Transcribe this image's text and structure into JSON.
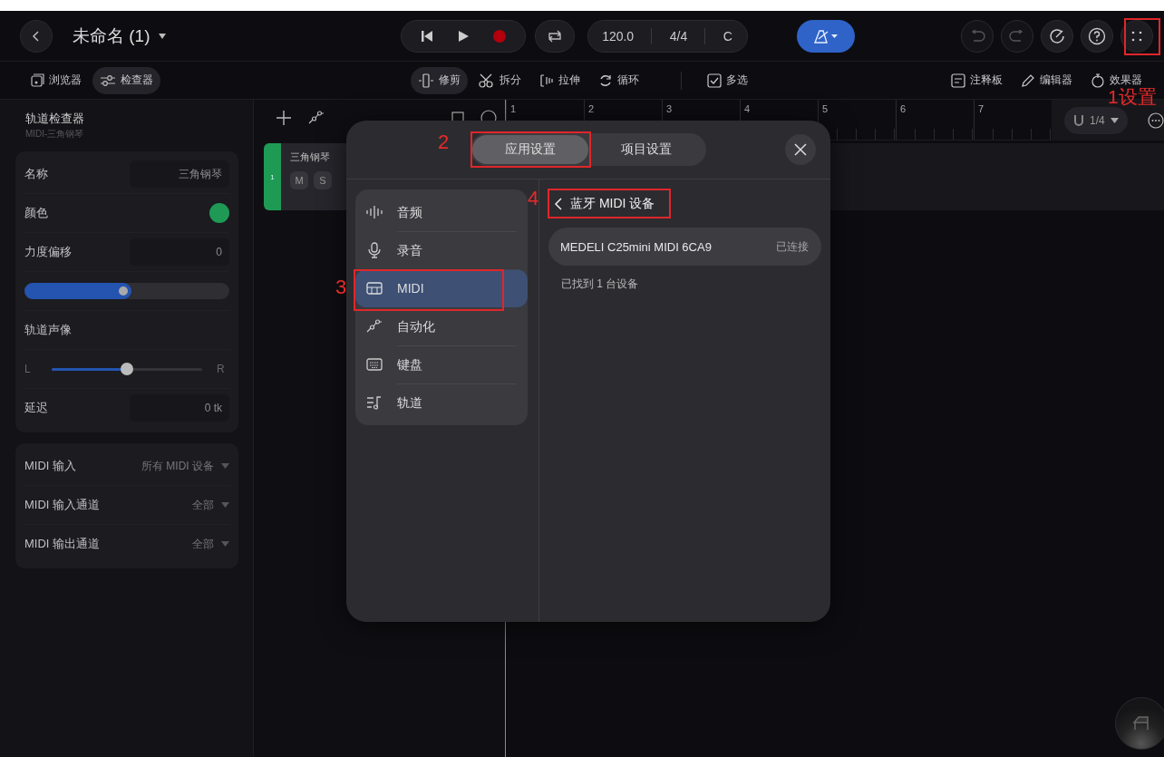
{
  "top_bar": {
    "title": "未命名 (1)",
    "tempo": "120.0",
    "time_signature": "4/4",
    "key": "C"
  },
  "toolbar": {
    "panels": [
      {
        "label": "浏览器",
        "selected": false
      },
      {
        "label": "检查器",
        "selected": true
      }
    ],
    "tools": [
      {
        "label": "修剪",
        "selected": true
      },
      {
        "label": "拆分",
        "selected": false
      },
      {
        "label": "拉伸",
        "selected": false
      },
      {
        "label": "循环",
        "selected": false
      },
      {
        "label": "多选",
        "selected": false
      }
    ],
    "views": [
      {
        "label": "注释板"
      },
      {
        "label": "编辑器"
      },
      {
        "label": "效果器"
      }
    ]
  },
  "inspector": {
    "title": "轨道检查器",
    "subtitle": "MIDI-三角钢琴",
    "rows": [
      {
        "kind": "field",
        "label": "名称",
        "value": "三角钢琴"
      },
      {
        "kind": "color",
        "label": "颜色",
        "color": "#1e9a55"
      },
      {
        "kind": "field",
        "label": "力度偏移",
        "value": "0"
      },
      {
        "kind": "slider",
        "level": 0.52
      },
      {
        "kind": "heading",
        "label": "轨道声像"
      },
      {
        "kind": "pan",
        "left": "L",
        "right": "R",
        "level": 0.5
      },
      {
        "kind": "field",
        "label": "延迟",
        "value": "0 tk"
      }
    ],
    "midi_rows": [
      {
        "label": "MIDI 输入",
        "value": "所有 MIDI 设备"
      },
      {
        "label": "MIDI 输入通道",
        "value": "全部"
      },
      {
        "label": "MIDI 输出通道",
        "value": "全部"
      }
    ]
  },
  "track": {
    "number": "1",
    "name": "三角钢琴",
    "color": "#1e9a55",
    "buttons": [
      "M",
      "S"
    ]
  },
  "ruler": [
    "1",
    "2",
    "3",
    "4",
    "5",
    "6",
    "7"
  ],
  "snap": "1/4",
  "settings_dialog": {
    "tabs": [
      {
        "label": "应用设置",
        "selected": true
      },
      {
        "label": "项目设置",
        "selected": false
      }
    ],
    "categories": [
      {
        "label": "音频",
        "selected": false
      },
      {
        "label": "录音",
        "selected": false
      },
      {
        "label": "MIDI",
        "selected": true
      },
      {
        "label": "自动化",
        "selected": false
      },
      {
        "label": "键盘",
        "selected": false
      },
      {
        "label": "轨道",
        "selected": false
      }
    ],
    "back_title": "蓝牙 MIDI 设备",
    "devices": [
      {
        "name": "MEDELI C25mini MIDI 6CA9",
        "status": "已连接"
      }
    ],
    "found_text": "已找到 1 台设备"
  },
  "annotations": [
    {
      "label": "1设置"
    },
    {
      "label": "2"
    },
    {
      "label": "3"
    },
    {
      "label": "4"
    }
  ]
}
